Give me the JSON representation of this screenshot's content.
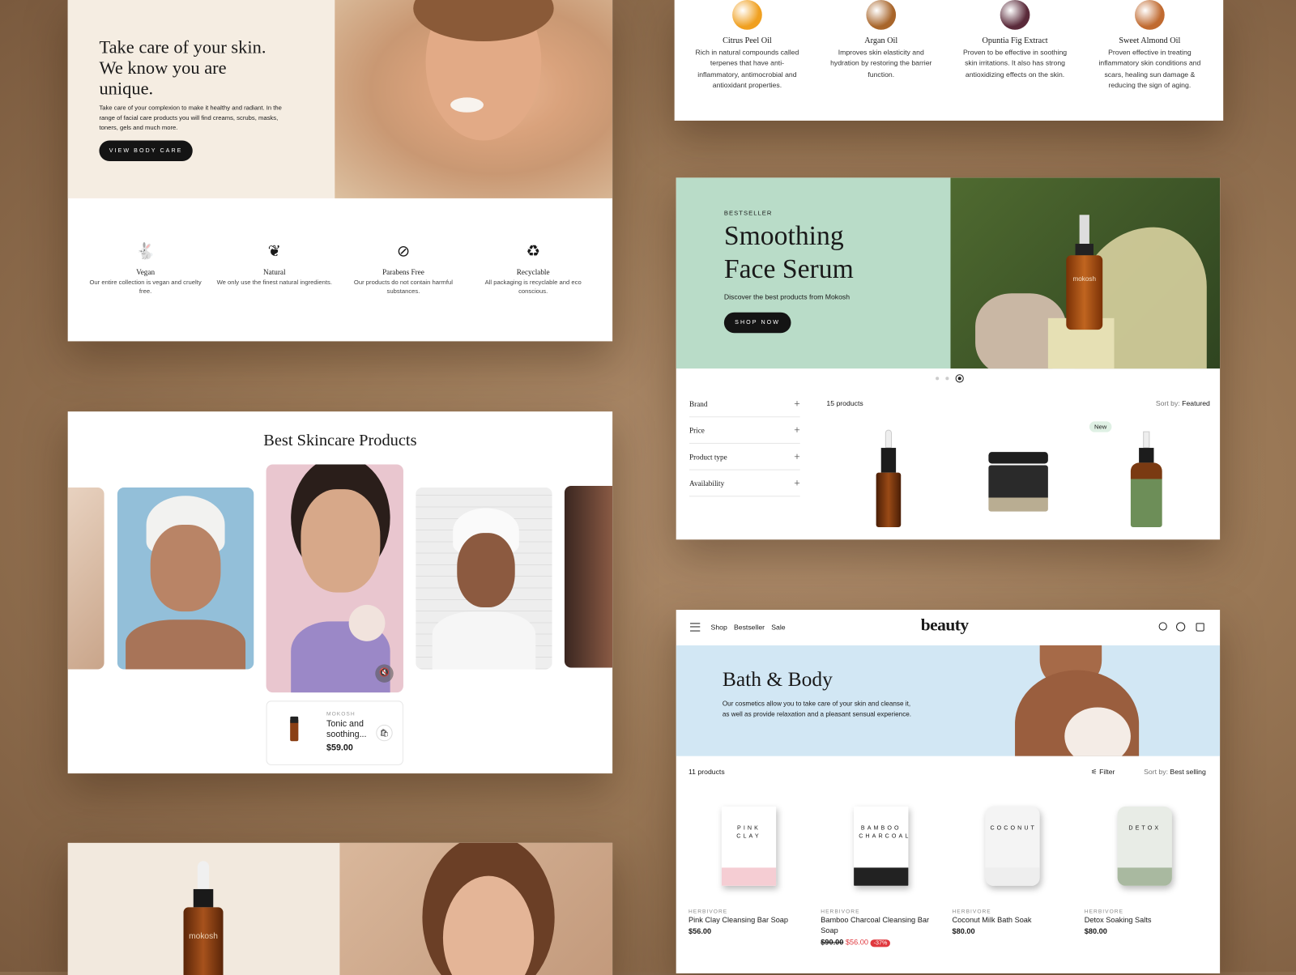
{
  "hero_skin": {
    "title_lines": [
      "Take care of your skin.",
      "We know you are",
      "unique."
    ],
    "body": "Take care of your complexion to make it healthy and radiant. In the range of facial care products you will find creams, scrubs, masks, toners, gels and much more.",
    "button": "View body care"
  },
  "features": [
    {
      "icon": "rabbit-icon",
      "title": "Vegan",
      "desc": "Our entire collection is vegan and cruelty free."
    },
    {
      "icon": "leaf-hand-icon",
      "title": "Natural",
      "desc": "We only use the finest natural ingredients."
    },
    {
      "icon": "no-parabens-icon",
      "title": "Parabens Free",
      "desc": "Our products do not contain harmful substances."
    },
    {
      "icon": "recycle-icon",
      "title": "Recyclable",
      "desc": "All packaging is recyclable and eco conscious."
    }
  ],
  "best": {
    "title": "Best Skincare Products",
    "product": {
      "brand": "MOKOSH",
      "name": "Tonic and soothing...",
      "price": "$59.00"
    }
  },
  "ingredients": [
    {
      "title": "Citrus Peel Oil",
      "desc": "Rich in natural compounds called terpenes that have anti-inflammatory, antimocrobial and antioxidant properties.",
      "color": "#f0a020"
    },
    {
      "title": "Argan Oil",
      "desc": "Improves skin elasticity and hydration by restoring the barrier function.",
      "color": "#a8652a"
    },
    {
      "title": "Opuntia Fig Extract",
      "desc": "Proven to be effective in soothing skin irritations. It also has strong antioxidizing effects on the skin.",
      "color": "#5a2a3a"
    },
    {
      "title": "Sweet Almond Oil",
      "desc": "Proven effective in treating inflammatory skin conditions and scars, healing sun damage & reducing the sign of aging.",
      "color": "#c06a30"
    }
  ],
  "serum": {
    "eyebrow": "BESTSELLER",
    "title_lines": [
      "Smoothing",
      "Face Serum"
    ],
    "subtitle": "Discover the best products from Mokosh",
    "button": "Shop now",
    "filters": [
      "Brand",
      "Price",
      "Product type",
      "Availability"
    ],
    "count": "15 products",
    "sort_label": "Sort by:",
    "sort_value": "Featured",
    "badge": "New",
    "bottle_label": "mokosh",
    "carousel_active": 3,
    "carousel_total": 3
  },
  "bath": {
    "nav": [
      "Shop",
      "Bestseller",
      "Sale"
    ],
    "logo": "beauty",
    "title": "Bath & Body",
    "body": "Our cosmetics allow you to take care of your skin and cleanse it, as well as provide relaxation and a pleasant sensual experience.",
    "count": "11 products",
    "filter": "Filter",
    "sort_label": "Sort by:",
    "sort_value": "Best selling",
    "products": [
      {
        "brand": "HERBIVORE",
        "name": "Pink Clay Cleansing Bar Soap",
        "price": "$56.00",
        "pack": "PINK CLAY"
      },
      {
        "brand": "HERBIVORE",
        "name": "Bamboo Charcoal Cleansing Bar Soap",
        "old_price": "$90.00",
        "price": "$56.00",
        "discount": "-37%",
        "pack": "BAMBOO CHARCOAL"
      },
      {
        "brand": "HERBIVORE",
        "name": "Coconut Milk Bath Soak",
        "price": "$80.00",
        "pack": "COCONUT"
      },
      {
        "brand": "HERBIVORE",
        "name": "Detox Soaking Salts",
        "price": "$80.00",
        "pack": "DETOX"
      }
    ]
  },
  "bottom": {
    "bottle_label": "mokosh"
  },
  "colors": {
    "cream": "#f5ede2",
    "mint": "#b9dcc8",
    "sky": "#d2e7f4",
    "sale": "#e0383e"
  }
}
